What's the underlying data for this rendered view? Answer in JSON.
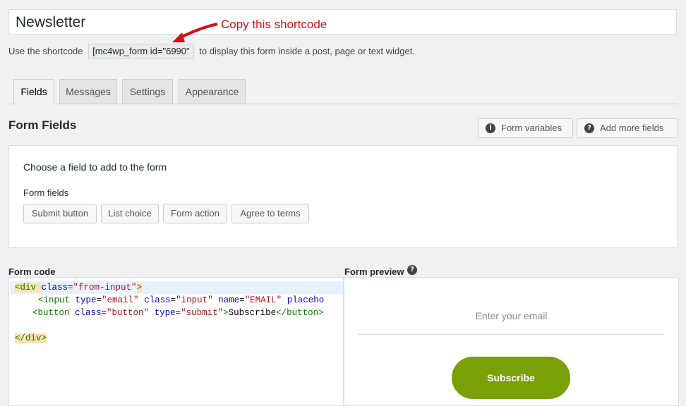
{
  "form": {
    "title": "Newsletter",
    "annotation": "Copy this shortcode",
    "shortcode_prefix": "Use the shortcode",
    "shortcode": "[mc4wp_form id=\"6990\"",
    "shortcode_suffix": "to display this form inside a post, page or text widget."
  },
  "tabs": [
    {
      "label": "Fields",
      "active": true
    },
    {
      "label": "Messages"
    },
    {
      "label": "Settings"
    },
    {
      "label": "Appearance"
    }
  ],
  "section": {
    "title": "Form Fields",
    "form_variables": "Form variables",
    "add_more_fields": "Add more fields",
    "info_icon": "i",
    "help_icon": "?"
  },
  "fields_panel": {
    "choose": "Choose a field to add to the form",
    "label": "Form fields",
    "buttons": [
      "Submit button",
      "List choice",
      "Form action",
      "Agree to terms"
    ]
  },
  "code": {
    "label": "Form code",
    "line1": {
      "open": "<div ",
      "attr": "class",
      "eq": "=",
      "val": "\"from-input\"",
      "close": ">"
    },
    "line2": {
      "open": "<input ",
      "a1": "type",
      "v1": "\"email\"",
      "a2": "class",
      "v2": "\"input\"",
      "a3": "name",
      "v3": "\"EMAIL\"",
      "a4": "placeho"
    },
    "line3": {
      "open": "<button ",
      "a1": "class",
      "v1": "\"button\"",
      "a2": "type",
      "v2": "\"submit\"",
      "gt": ">",
      "text": "Subscribe",
      "close": "</button>"
    },
    "line5": "</div>"
  },
  "preview": {
    "label": "Form preview",
    "email_placeholder": "Enter your email",
    "subscribe": "Subscribe"
  },
  "colors": {
    "accent_red": "#d40f17",
    "subscribe_green": "#79a006"
  }
}
